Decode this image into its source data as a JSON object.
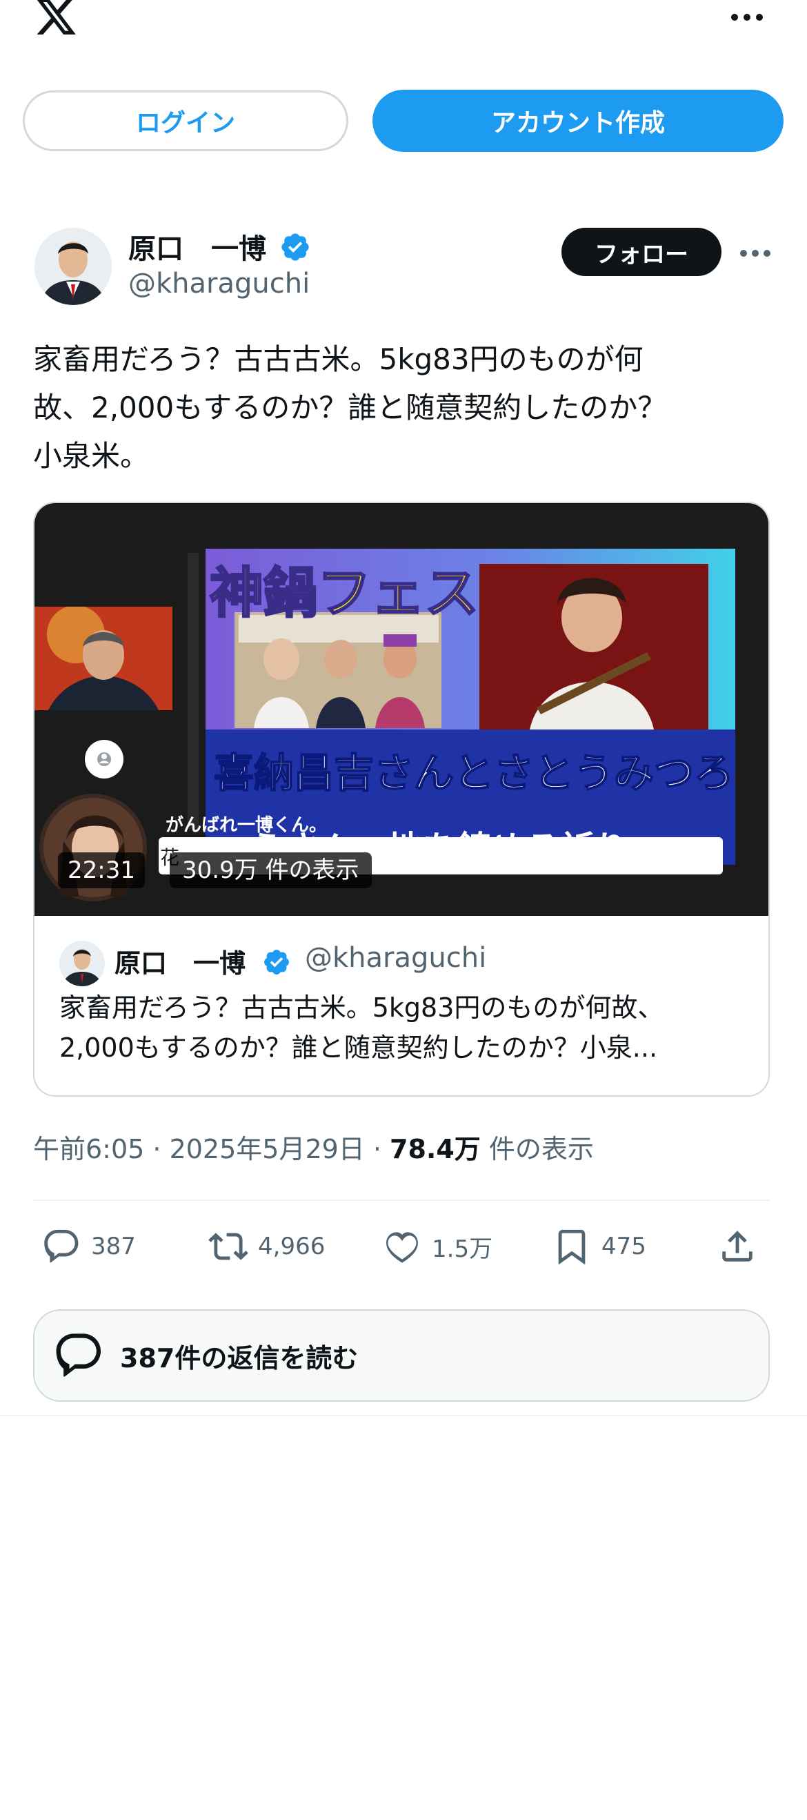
{
  "top_bar": {
    "logo_icon": "x-logo-icon",
    "more_icon": "more-horizontal-icon",
    "login_label": "ログイン",
    "signup_label": "アカウント作成"
  },
  "post": {
    "author_name": "原口　一博",
    "author_handle": "@kharaguchi",
    "follow_label": "フォロー",
    "text": "家畜用だろう？古古古米。5kg83円のものが何\n故、2,000もするのか？誰と随意契約したのか？\n小泉米。",
    "timestamp": "午前6:05 · 2025年5月29日 · ",
    "views_count": "78.4万",
    "views_label": " 件の表示"
  },
  "media": {
    "thumb_title": "神鍋フェス",
    "thumb_subtitle": "喜納昌吉さんとさとうみつろ",
    "thumb_subtitle2": "うさん　地を鎮める祈り",
    "chat_name": "がんばれ一博くん。",
    "chat_msg": "花",
    "duration": "22:31",
    "view_count": "30.9万 件の表示"
  },
  "quote": {
    "author_name": "原口　一博",
    "author_handle": "@kharaguchi",
    "text": "家畜用だろう？古古古米。5kg83円のものが何故、\n2,000もするのか？誰と随意契約したのか？小泉..."
  },
  "actions": {
    "replies": "387",
    "retweets": "4,966",
    "likes": "1.5万",
    "bookmarks": "475",
    "read_replies_label": "387件の返信を読む"
  },
  "colors": {
    "accent": "#1d9bf0",
    "text": "#0f1419",
    "secondary": "#536471",
    "border": "#cfd9de"
  }
}
